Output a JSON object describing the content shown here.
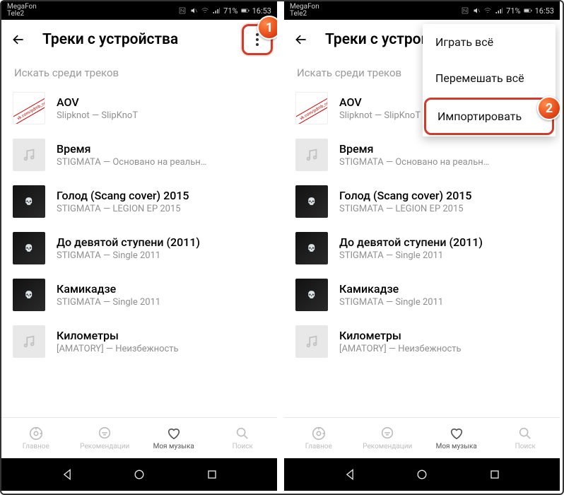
{
  "status": {
    "carrier1": "MegaFon",
    "carrier2": "Tele2",
    "battery_pct": "71%",
    "time": "16:53"
  },
  "header": {
    "title": "Треки с устройства"
  },
  "search": {
    "placeholder": "Искать среди треков"
  },
  "tracks": [
    {
      "title": "AOV",
      "subtitle": "Slipknot — SlipKnoT",
      "thumb": "aov",
      "stripe": "vk.com/pdmb_core"
    },
    {
      "title": "Время",
      "subtitle": "STIGMATA — Основано на реальн…",
      "thumb": "plain"
    },
    {
      "title": "Голод (Scang cover) 2015",
      "subtitle": "STIGMATA — LEGION EP 2015",
      "thumb": "dark"
    },
    {
      "title": "До девятой ступени (2011)",
      "subtitle": "STIGMATA — Single 2011",
      "thumb": "dark"
    },
    {
      "title": "Камикадзе",
      "subtitle": "STIGMATA — Single 2011",
      "thumb": "dark"
    },
    {
      "title": "Километры",
      "subtitle": "[AMATORY] — Неизбежность",
      "thumb": "plain"
    }
  ],
  "nav": {
    "home": "Главное",
    "recs": "Рекомендации",
    "my": "Моя музыка",
    "search": "Поиск"
  },
  "menu": {
    "play_all": "Играть всё",
    "shuffle_all": "Перемешать всё",
    "import": "Импортировать"
  },
  "callouts": {
    "one": "1",
    "two": "2"
  }
}
